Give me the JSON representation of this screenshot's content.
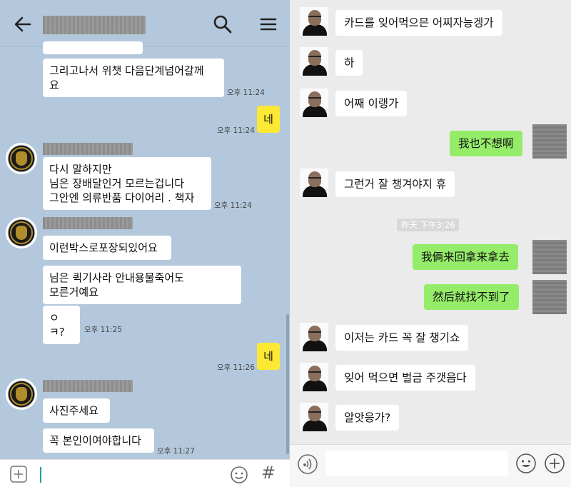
{
  "left_chat": {
    "messages": [
      {
        "text": "그리고나서 위챗  다음단계넘어갈께\n요",
        "time": "오후 11:24"
      },
      {
        "mine": "네",
        "time": "오후 11:24"
      },
      {
        "text": "다시 말하지만\n님은 장배달인거 모르는겁니다\n그안엔  의류반품 다이어리 . 책자",
        "time": "오후 11:24"
      },
      {
        "text": "이런박스로포장되있어요"
      },
      {
        "text": "님은 퀵기사라 안내용물죽어도\n모른거예요"
      },
      {
        "text": "ㅇㅋ?",
        "time": "오후 11:25"
      },
      {
        "mine": "네",
        "time": "오후 11:26"
      },
      {
        "text": "사진주세요"
      },
      {
        "text": "꼭 본인이여야합니다",
        "time": "오후 11:27"
      }
    ],
    "icons": [
      "back-arrow-icon",
      "search-icon",
      "menu-icon",
      "plus-icon",
      "emoji-icon",
      "hash-icon"
    ],
    "hash_glyph": "#"
  },
  "right_chat": {
    "messages": [
      {
        "from": "other",
        "text": "카드를 잊어먹으믄 어찌자능겡가"
      },
      {
        "from": "other",
        "text": "하"
      },
      {
        "from": "other",
        "text": "어째 이랭가"
      },
      {
        "from": "me",
        "text": "我也不想啊"
      },
      {
        "from": "other",
        "text": "그런거 잘 챙겨야지 휴"
      },
      {
        "from": "me",
        "text": "我俩来回拿来拿去"
      },
      {
        "from": "me",
        "text": "然后就找不到了"
      },
      {
        "from": "other",
        "text": "이저는 카드 꼭 잘 챙기쇼"
      },
      {
        "from": "other",
        "text": "잊어 먹으면 벌금 주갯음다"
      },
      {
        "from": "other",
        "text": "알앗응가?"
      }
    ],
    "timestamp": "昨天 下午3:26",
    "icons": [
      "voice-icon",
      "emoji-icon",
      "plus-icon"
    ]
  },
  "colors": {
    "kakao_bg": "#b3c8dc",
    "kakao_mine": "#fde933",
    "wechat_bg": "#ebebeb",
    "wechat_mine": "#95ec69"
  }
}
